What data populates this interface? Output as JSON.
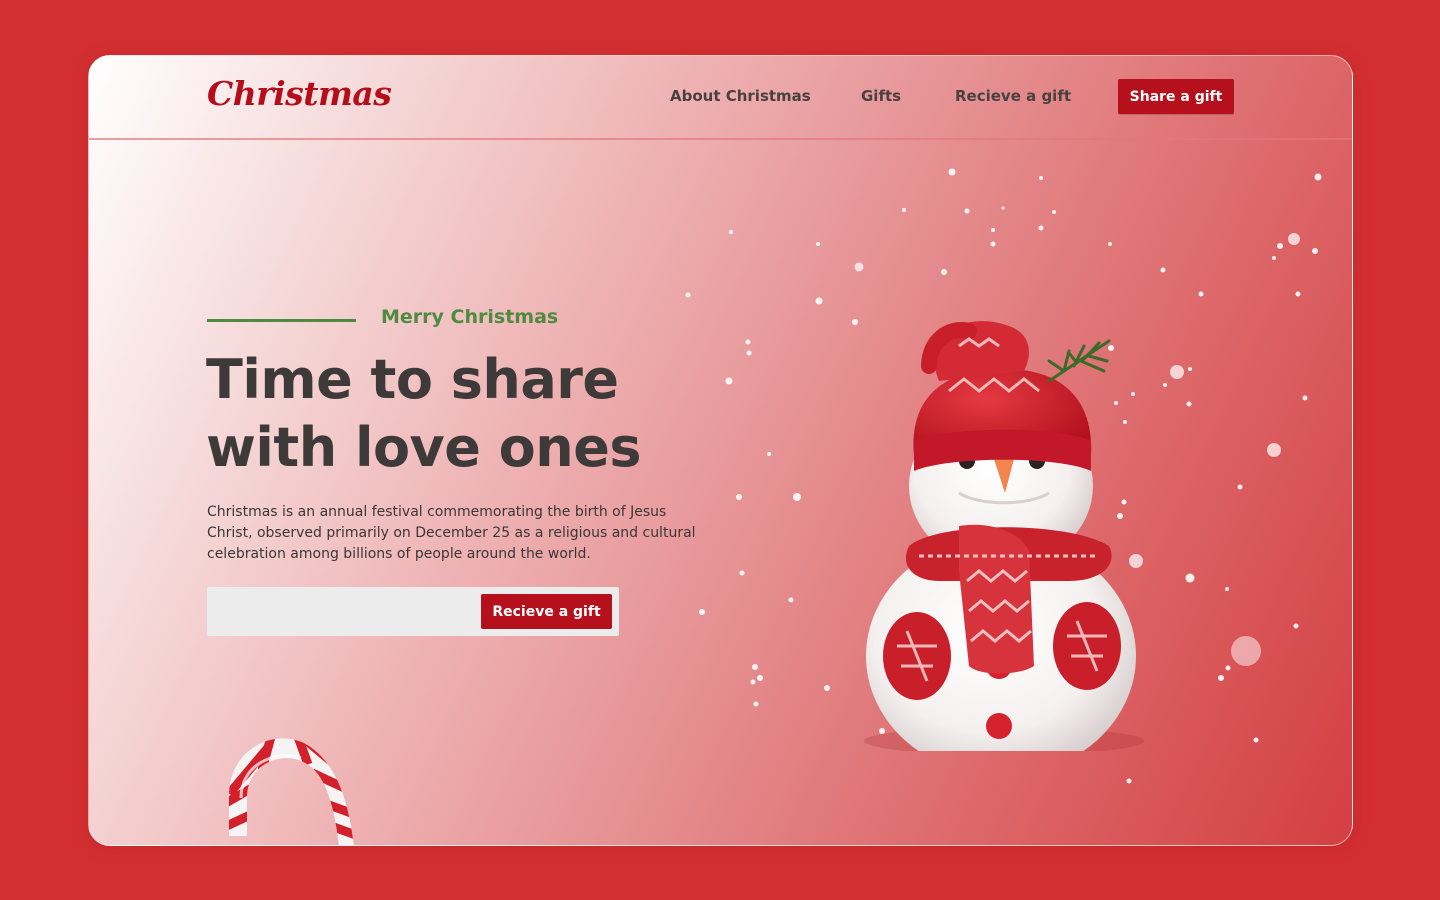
{
  "brand": {
    "logo": "Christmas"
  },
  "nav": {
    "links": [
      "About Christmas",
      "Gifts",
      "Recieve a gift"
    ],
    "cta": "Share a gift"
  },
  "hero": {
    "kicker": "Merry Christmas",
    "headline_line1": "Time to share",
    "headline_line2": "with love ones",
    "description": "Christmas is an annual festival commemorating the birth of Jesus Christ, observed primarily on December 25 as a religious and cultural celebration among billions of people around the world.",
    "input_placeholder": "",
    "input_button": "Recieve a gift"
  },
  "colors": {
    "page_bg": "#d32f32",
    "accent_red": "#b6101c",
    "accent_green": "#4e8a40",
    "text_dark": "#3f3a3a"
  },
  "icons": [
    "snowman-illustration",
    "candy-cane-illustration",
    "snowflake-dots"
  ]
}
